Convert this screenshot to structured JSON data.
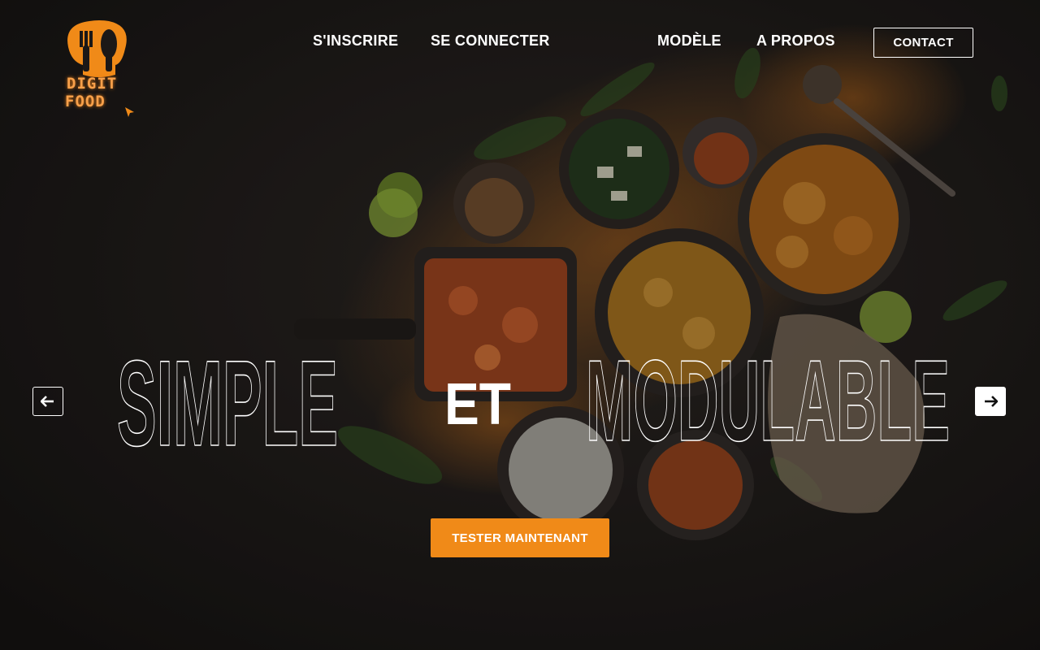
{
  "brand": {
    "logo_line1": "DIGIT",
    "logo_line2": "FOOD",
    "accent_color": "#f08a18"
  },
  "nav": {
    "signup": "S'INSCRIRE",
    "login": "SE CONNECTER",
    "model": "MODÈLE",
    "about": "A PROPOS",
    "contact": "CONTACT"
  },
  "hero": {
    "word1": "SIMPLE",
    "word2": "ET",
    "word3": "MODULABLE",
    "cta": "TESTER MAINTENANT",
    "prev_icon": "arrow-left-icon",
    "next_icon": "arrow-right-icon"
  }
}
